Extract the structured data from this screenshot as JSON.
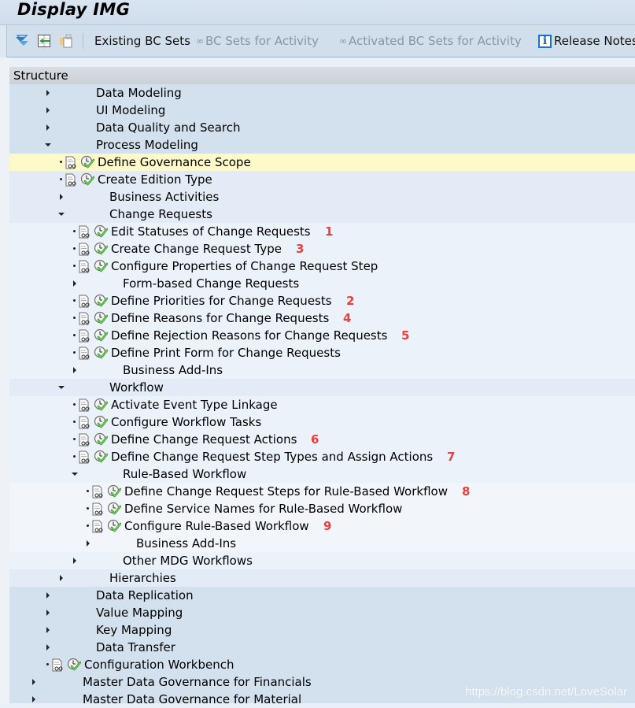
{
  "window": {
    "title": "Display IMG"
  },
  "toolbar": {
    "icons": [
      "expand-subtree-icon",
      "position-cursor-icon",
      "copy-node-icon"
    ],
    "existing_bc_sets": "Existing BC Sets",
    "bc_sets_for_activity": "BC Sets for Activity",
    "activated_bc_sets_for_activity": "Activated BC Sets for Activity",
    "release_notes": "Release Notes",
    "release_notes_icon": "info-icon"
  },
  "structure": {
    "header": "Structure"
  },
  "tree": [
    {
      "level": 2,
      "type": "folder",
      "expanded": false,
      "label": "Data Modeling"
    },
    {
      "level": 2,
      "type": "folder",
      "expanded": false,
      "label": "UI Modeling"
    },
    {
      "level": 2,
      "type": "folder",
      "expanded": false,
      "label": "Data Quality and Search"
    },
    {
      "level": 2,
      "type": "folder",
      "expanded": true,
      "label": "Process Modeling"
    },
    {
      "level": 3,
      "type": "activity",
      "label": "Define Governance Scope",
      "selected": true
    },
    {
      "level": 3,
      "type": "activity",
      "label": "Create Edition Type"
    },
    {
      "level": 3,
      "type": "folder",
      "expanded": false,
      "label": "Business Activities"
    },
    {
      "level": 3,
      "type": "folder",
      "expanded": true,
      "label": "Change Requests"
    },
    {
      "level": 4,
      "type": "activity",
      "label": "Edit Statuses of Change Requests",
      "badge": "1"
    },
    {
      "level": 4,
      "type": "activity",
      "label": "Create Change Request Type",
      "badge": "3"
    },
    {
      "level": 4,
      "type": "activity",
      "label": "Configure Properties of Change Request Step"
    },
    {
      "level": 4,
      "type": "folder",
      "expanded": false,
      "label": "Form-based Change Requests"
    },
    {
      "level": 4,
      "type": "activity",
      "label": "Define Priorities for Change Requests",
      "badge": "2"
    },
    {
      "level": 4,
      "type": "activity",
      "label": "Define Reasons for Change Requests",
      "badge": "4"
    },
    {
      "level": 4,
      "type": "activity",
      "label": "Define Rejection Reasons for Change Requests",
      "badge": "5"
    },
    {
      "level": 4,
      "type": "activity",
      "label": "Define Print Form for Change Requests"
    },
    {
      "level": 4,
      "type": "folder",
      "expanded": false,
      "label": "Business Add-Ins"
    },
    {
      "level": 3,
      "type": "folder",
      "expanded": true,
      "label": "Workflow"
    },
    {
      "level": 4,
      "type": "activity",
      "label": "Activate Event Type Linkage"
    },
    {
      "level": 4,
      "type": "activity",
      "label": "Configure Workflow Tasks"
    },
    {
      "level": 4,
      "type": "activity",
      "label": "Define Change Request Actions",
      "badge": "6"
    },
    {
      "level": 4,
      "type": "activity",
      "label": "Define Change Request Step Types and Assign Actions",
      "badge": "7"
    },
    {
      "level": 4,
      "type": "folder",
      "expanded": true,
      "label": "Rule-Based Workflow"
    },
    {
      "level": 5,
      "type": "activity",
      "label": "Define Change Request Steps for Rule-Based Workflow",
      "badge": "8"
    },
    {
      "level": 5,
      "type": "activity",
      "label": "Define Service Names for Rule-Based Workflow"
    },
    {
      "level": 5,
      "type": "activity",
      "label": "Configure Rule-Based Workflow",
      "badge": "9"
    },
    {
      "level": 5,
      "type": "folder",
      "expanded": false,
      "label": "Business Add-Ins"
    },
    {
      "level": 4,
      "type": "folder",
      "expanded": false,
      "label": "Other MDG Workflows"
    },
    {
      "level": 3,
      "type": "folder",
      "expanded": false,
      "label": "Hierarchies"
    },
    {
      "level": 2,
      "type": "folder",
      "expanded": false,
      "label": "Data Replication"
    },
    {
      "level": 2,
      "type": "folder",
      "expanded": false,
      "label": "Value Mapping"
    },
    {
      "level": 2,
      "type": "folder",
      "expanded": false,
      "label": "Key Mapping"
    },
    {
      "level": 2,
      "type": "folder",
      "expanded": false,
      "label": "Data Transfer"
    },
    {
      "level": 2,
      "type": "activity",
      "label": "Configuration Workbench"
    },
    {
      "level": 1,
      "type": "folder",
      "expanded": false,
      "label": "Master Data Governance for Financials"
    },
    {
      "level": 1,
      "type": "folder",
      "expanded": false,
      "label": "Master Data Governance for Material"
    }
  ],
  "colors": {
    "badge": "#e8403f",
    "selected_row": "#fdf9c8",
    "toolbar_bg": "#d1deeb"
  },
  "watermark": "https://blog.csdn.net/LoveSolar"
}
